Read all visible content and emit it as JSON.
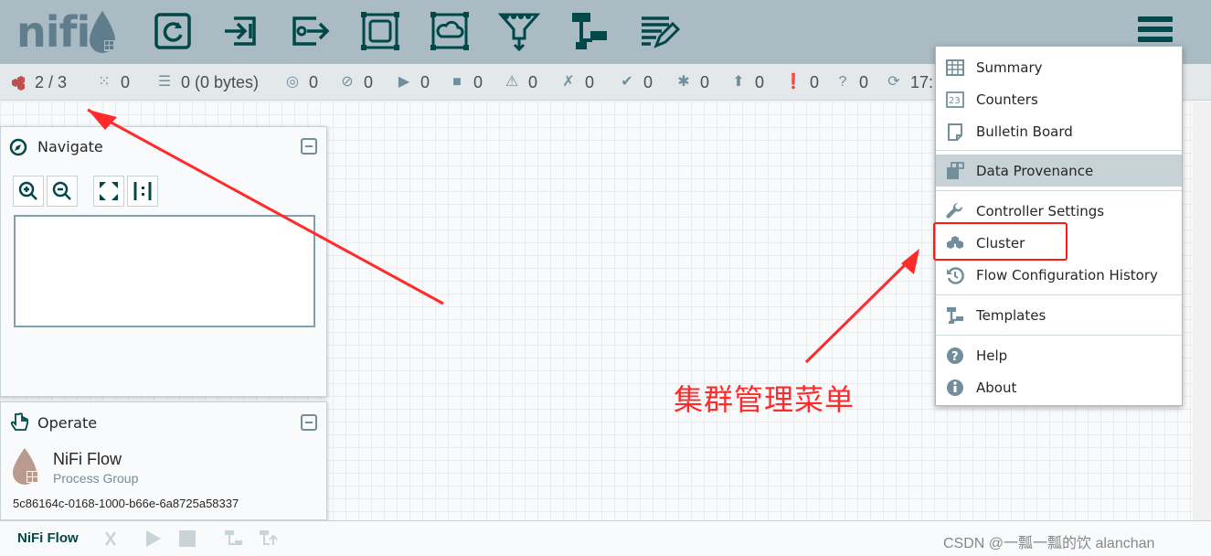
{
  "header": {
    "logo_text": "nifi",
    "tools": [
      {
        "name": "processor-icon"
      },
      {
        "name": "input-port-icon"
      },
      {
        "name": "output-port-icon"
      },
      {
        "name": "process-group-icon"
      },
      {
        "name": "remote-process-group-icon"
      },
      {
        "name": "funnel-icon"
      },
      {
        "name": "template-icon"
      },
      {
        "name": "label-icon"
      }
    ]
  },
  "status": {
    "cluster": "2 / 3",
    "transmitting": "0",
    "queued": "0 (0 bytes)",
    "transmitting_rpg": "0",
    "not_transmitting": "0",
    "running": "0",
    "stopped": "0",
    "invalid": "0",
    "disabled": "0",
    "up_to_date": "0",
    "locally_modified": "0",
    "stale": "0",
    "locally_modified_stale": "0",
    "sync_failure": "0",
    "last_refresh": "17:"
  },
  "navigate": {
    "title": "Navigate"
  },
  "operate": {
    "title": "Operate",
    "name": "NiFi Flow",
    "type": "Process Group",
    "id": "5c86164c-0168-1000-b66e-6a8725a58337"
  },
  "footer": {
    "breadcrumb": "NiFi Flow",
    "watermark": "CSDN @一瓢一瓢的饮 alanchan"
  },
  "menu": {
    "items": [
      {
        "label": "Summary",
        "icon": "table-icon"
      },
      {
        "label": "Counters",
        "icon": "counters-icon"
      },
      {
        "label": "Bulletin Board",
        "icon": "bulletin-icon"
      },
      {
        "label": "Data Provenance",
        "icon": "provenance-icon"
      },
      {
        "label": "Controller Settings",
        "icon": "wrench-icon"
      },
      {
        "label": "Cluster",
        "icon": "cluster-icon"
      },
      {
        "label": "Flow Configuration History",
        "icon": "history-icon"
      },
      {
        "label": "Templates",
        "icon": "templates-icon"
      },
      {
        "label": "Help",
        "icon": "help-icon"
      },
      {
        "label": "About",
        "icon": "info-icon"
      }
    ]
  },
  "annotation": {
    "text": "集群管理菜单",
    "color": "#ff2a2a"
  },
  "colors": {
    "header": "#aabbc3",
    "accent": "#004849",
    "muted": "#728e9b"
  }
}
